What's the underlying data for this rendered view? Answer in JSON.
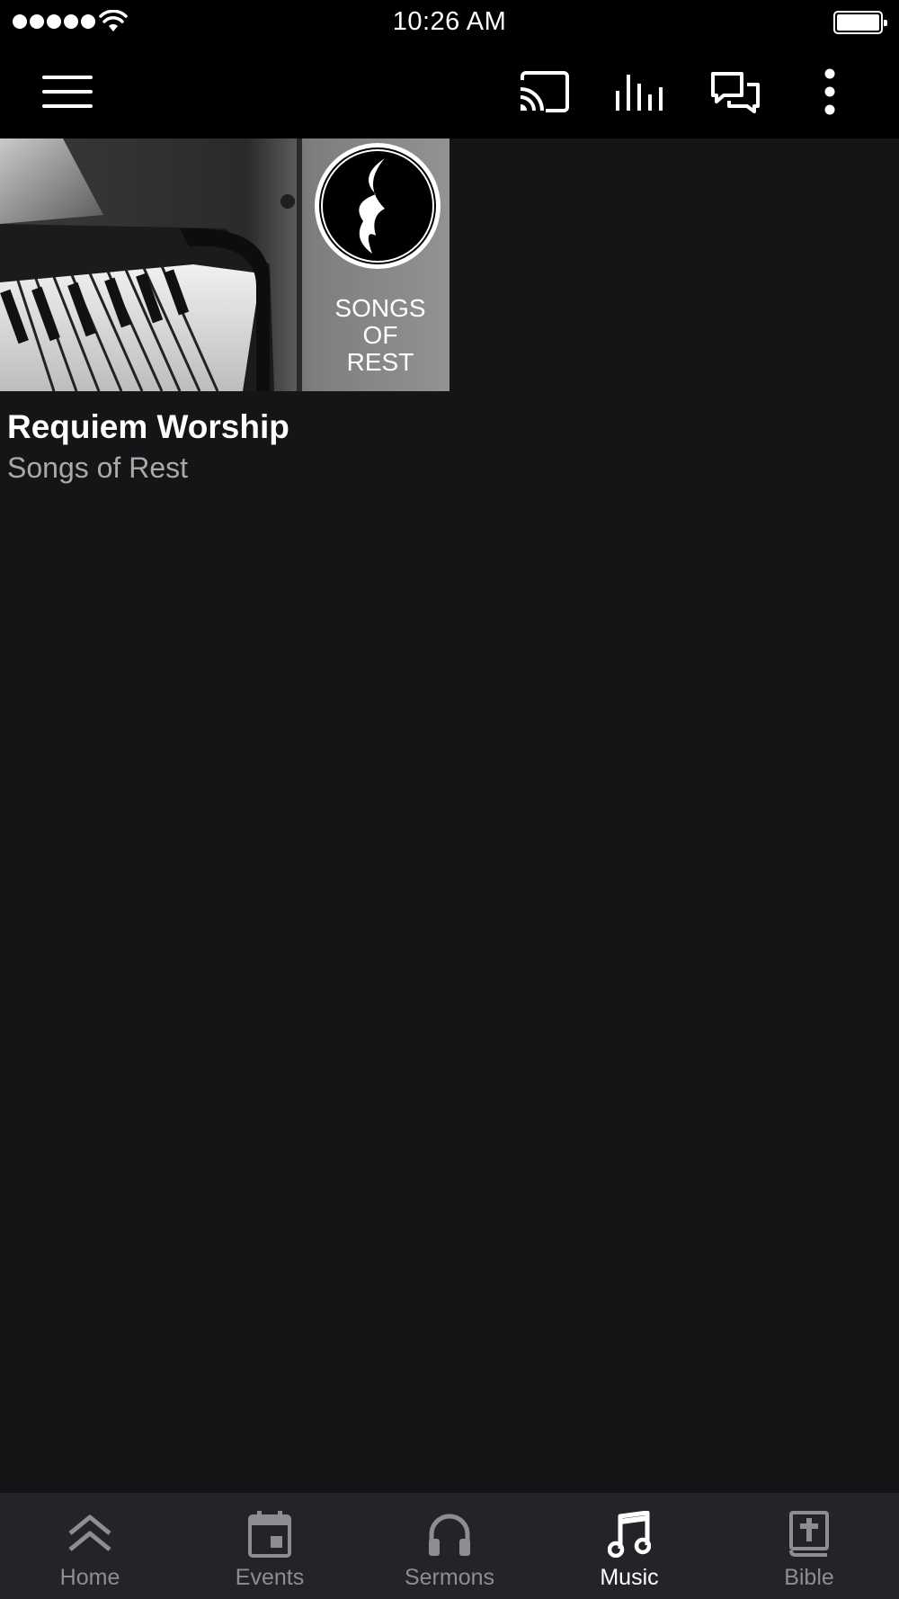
{
  "status_bar": {
    "time": "10:26 AM",
    "signal_bars": 5,
    "battery_level": 1.0,
    "icons": [
      "signal-dots-icon",
      "wifi-icon",
      "battery-icon"
    ]
  },
  "toolbar": {
    "icons": [
      "menu-icon",
      "cast-icon",
      "equalizer-icon",
      "chat-icon",
      "more-vertical-icon"
    ]
  },
  "albums": [
    {
      "title": "Requiem Worship",
      "subtitle": "Songs of Rest",
      "cover_text": [
        "SONGS",
        "OF",
        "REST"
      ]
    }
  ],
  "tabs": [
    {
      "label": "Home",
      "icon": "double-chevron-up-icon",
      "active": false
    },
    {
      "label": "Events",
      "icon": "calendar-icon",
      "active": false
    },
    {
      "label": "Sermons",
      "icon": "headphones-icon",
      "active": false
    },
    {
      "label": "Music",
      "icon": "music-note-icon",
      "active": true
    },
    {
      "label": "Bible",
      "icon": "bible-icon",
      "active": false
    }
  ],
  "colors": {
    "background": "#141517",
    "bars": "#000000",
    "tabbar": "#232427",
    "inactive_tab": "#8e8e92",
    "active_tab": "#ffffff",
    "subtitle": "#a9a9ac"
  }
}
